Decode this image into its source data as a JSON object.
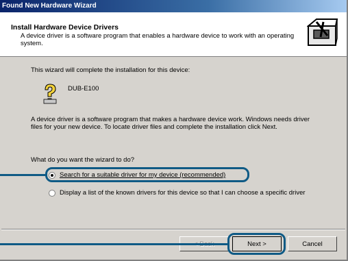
{
  "window": {
    "title": "Found New Hardware Wizard"
  },
  "header": {
    "title": "Install Hardware Device Drivers",
    "description": "A device driver is a software program that enables a hardware device to work with an operating system."
  },
  "body": {
    "intro": "This wizard will complete the installation for this device:",
    "device_name": "DUB-E100",
    "explanation": "A device driver is a software program that makes a hardware device work. Windows needs driver files for your new device. To locate driver files and complete the installation click Next.",
    "question": "What do you want the wizard to do?",
    "option_search_label": "Search for a suitable driver for my device (recommended)",
    "option_search_selected": true,
    "option_display_label": "Display a list of the known drivers for this device so that I can choose a specific driver",
    "option_display_selected": false
  },
  "buttons": {
    "back_label": "< Back",
    "next_label": "Next >",
    "cancel_label": "Cancel"
  },
  "colors": {
    "callout": "#0f5a85",
    "titlebar": "#0a246a",
    "face": "#d6d3ce"
  },
  "icons": {
    "wizard": "hardware-box-icon",
    "device": "unknown-device-question-icon"
  }
}
